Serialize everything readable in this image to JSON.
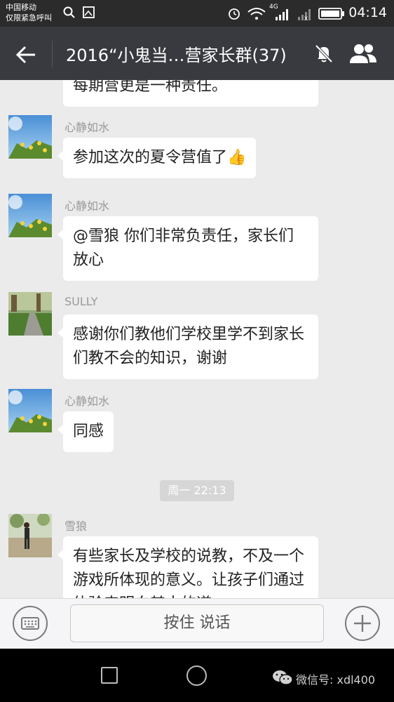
{
  "status_bar": {
    "carrier_line1": "中国移动",
    "carrier_line2": "仅限紧急呼叫",
    "network": "4G",
    "time": "04:14"
  },
  "header": {
    "title": "2016“小鬼当…营家长群(37)"
  },
  "messages": [
    {
      "sender": "",
      "text": "每期营更是一种责任。"
    },
    {
      "sender": "心静如水",
      "text": "参加这次的夏令营值了👍"
    },
    {
      "sender": "心静如水",
      "text": "@雪狼 你们非常负责任，家长们放心"
    },
    {
      "sender": "SULLY",
      "text": "感谢你们教他们学校里学不到家长们教不会的知识，谢谢"
    },
    {
      "sender": "心静如水",
      "text": "同感"
    },
    {
      "sender": "雪狼",
      "text": "有些家长及学校的说教，不及一个游戏所体现的意义。让孩子们通过体验来明白其中的道"
    }
  ],
  "time_separator": "周一 22:13",
  "input_bar": {
    "hold_to_talk": "按住 说话"
  },
  "watermark": "微信号: xdl400",
  "colors": {
    "title_bar": "#393a3f",
    "status_bar": "#2b2b2b",
    "chat_background": "#ebebeb",
    "bubble": "#ffffff"
  },
  "icons": [
    "back-arrow-icon",
    "mute-icon",
    "group-members-icon",
    "keyboard-icon",
    "plus-icon",
    "wechat-icon"
  ]
}
